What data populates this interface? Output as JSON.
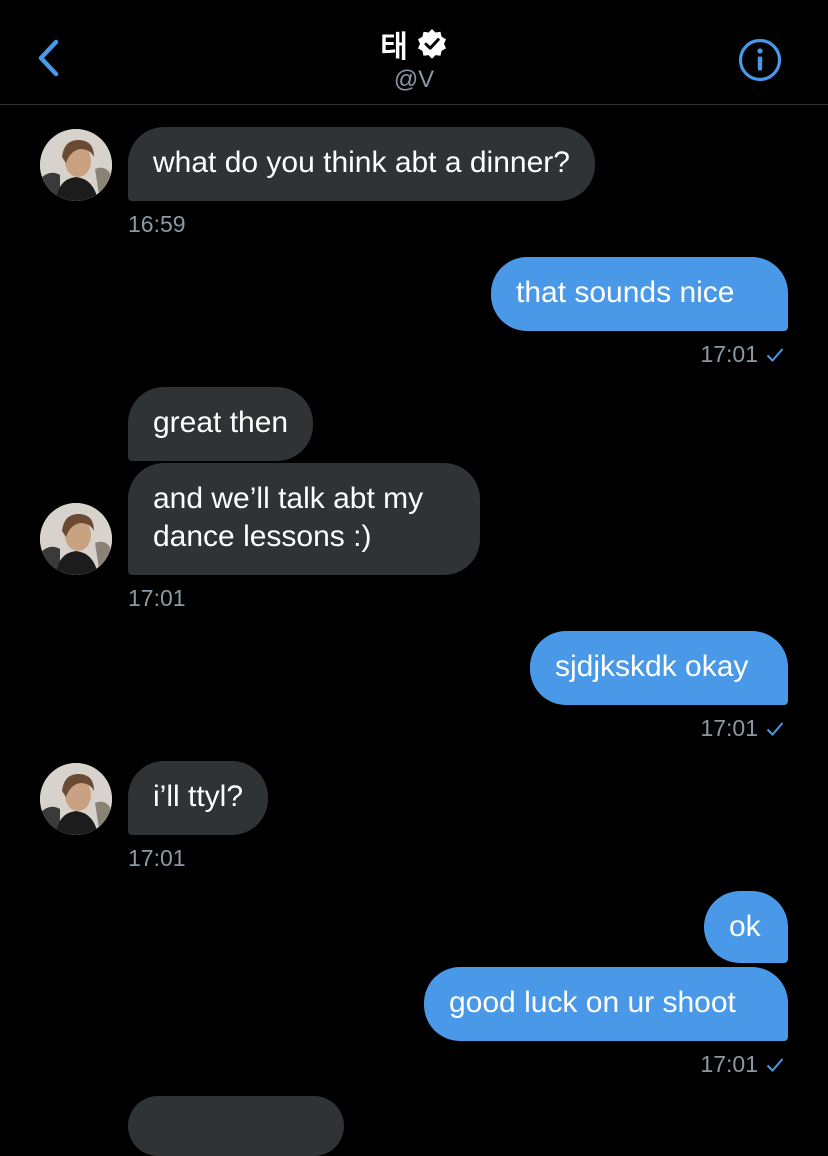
{
  "header": {
    "name": "태",
    "handle": "@V",
    "back_icon": "chevron-left-icon",
    "info_icon": "info-icon",
    "verified_icon": "verified-badge-icon",
    "accent_color": "#4a99e9"
  },
  "messages": [
    {
      "direction": "in",
      "text": "what do you think abt a dinner?"
    },
    {
      "direction": "out",
      "text": "that sounds nice"
    },
    {
      "direction": "in",
      "text": "great then"
    },
    {
      "direction": "in",
      "text_lines": [
        "and we’ll talk abt my",
        "dance lessons :)"
      ]
    },
    {
      "direction": "out",
      "text": "sjdjkskdk okay"
    },
    {
      "direction": "in",
      "text": "i’ll ttyl?"
    },
    {
      "direction": "out",
      "text": "ok"
    },
    {
      "direction": "out",
      "text": "good luck on ur shoot"
    }
  ],
  "timestamps": {
    "t1": "16:59",
    "t2": "17:01",
    "t3": "17:01",
    "t4": "17:01",
    "t5": "17:01",
    "t6": "17:01"
  },
  "colors": {
    "background": "#000000",
    "incoming_bubble": "#2f3336",
    "outgoing_bubble": "#4a99e9",
    "timestamp": "#8b98a5"
  }
}
